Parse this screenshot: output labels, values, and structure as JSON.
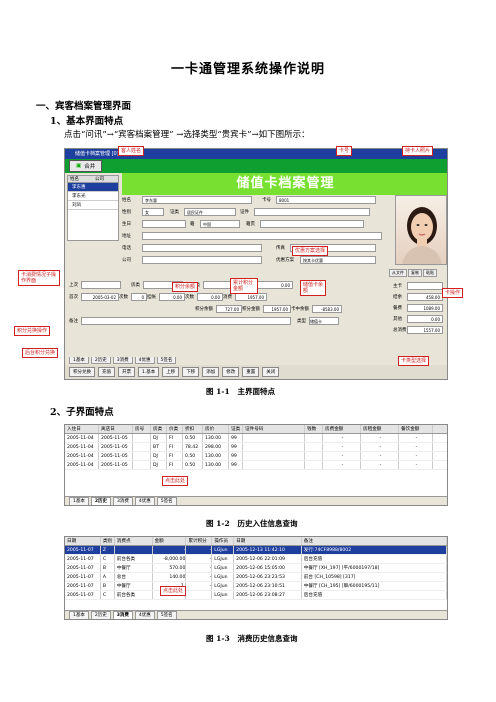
{
  "doc": {
    "title": "一卡通管理系统操作说明",
    "section1": "一、宾客档案管理界面",
    "sub1": "1、基本界面特点",
    "para1": "点击“问讯”→“宾客档案管理” →选择类型“贵宾卡”→如下图所示：",
    "sub2": "2、子界面特点"
  },
  "fig1": {
    "window_title": "储值卡档案管理 [0]",
    "merge_button": "合并",
    "card_title": "储值卡档案管理",
    "list_headers": [
      "姓名",
      "公司"
    ],
    "list_rows": [
      "李东惠",
      "李东光",
      "刘凤"
    ],
    "form": {
      "name_label": "姓名",
      "name_value": "李东惠",
      "card_label": "卡号",
      "card_value": "8001",
      "gender_label": "性别",
      "gender_value": "女",
      "idtype_label": "证类",
      "idtype_value": "居民证件",
      "idno_label": "证件",
      "birthday_label": "生日",
      "nation_label": "籍",
      "nation_value": "中国",
      "ethnic_label": "籍贯",
      "address_label": "地址",
      "phone_label": "电话",
      "fax_label": "传真",
      "company_label": "公司",
      "plan_label": "优惠方案",
      "plan_value": "按其卡优惠"
    },
    "stats": {
      "r1": [
        "上次",
        "房类",
        "价类",
        "房号",
        "0.00"
      ],
      "r2": [
        "首次",
        "2005-03-02",
        "次数",
        "0",
        "挂帐",
        "0.00",
        "次数",
        "0.00",
        "消费",
        "1957.00"
      ],
      "r3": [
        "积分余额",
        "727.00",
        "积分金额",
        "1957.00",
        "卡中余额",
        "-8583.00"
      ],
      "r4": [
        "类型",
        "储值卡",
        "总消费",
        "1557.00"
      ],
      "remark_label": "备注"
    },
    "right": [
      {
        "k": "主卡",
        "v": ""
      },
      {
        "k": "结余",
        "v": "458.00"
      },
      {
        "k": "餐费",
        "v": "1089.00"
      },
      {
        "k": "其他",
        "v": "0.00"
      },
      {
        "k": "总消费",
        "v": "1557.00"
      }
    ],
    "photo_buttons": [
      "从文件",
      "复制",
      "粘贴"
    ],
    "tabs": [
      "1基本",
      "2历史",
      "3消费",
      "4优惠",
      "5签名"
    ],
    "toolbar": [
      "积分兑换",
      "充值",
      "开票",
      "1.基本",
      "上移",
      "下移",
      "添加",
      "修改",
      "重置",
      "关闭"
    ]
  },
  "callouts": {
    "name_change": "客人姓名",
    "card_no": "卡号",
    "holder_photo": "持卡人照片",
    "plan_select": "优惠方案选择",
    "spend_detail": "卡消费情况子操作界面",
    "points_balance": "积分余额",
    "accum_points": "累计积分金额",
    "stored_balance": "储值卡余额",
    "card_action": "卡操作",
    "points_redeem": "积分兑换操作",
    "bg_points": "后台积分兑换",
    "card_type": "卡类型选择",
    "click_here": "点击此处",
    "click_here2": "点击此处"
  },
  "fig1_caption": {
    "num": "图 1-1",
    "text": "主界面特点"
  },
  "fig2": {
    "headers": [
      "入住日",
      "离店日",
      "房号",
      "房类",
      "价类",
      "折扣",
      "房价",
      "证类",
      "证件号码",
      "钱数",
      "房费金额",
      "房租金额",
      "餐饮金额"
    ],
    "rows": [
      [
        "2005-11-04",
        "2005-11-05",
        "",
        "DJ",
        "FI",
        "0.50",
        "130.00",
        "99",
        "",
        "",
        "-",
        "-",
        "-"
      ],
      [
        "2005-11-04",
        "2005-11-05",
        "",
        "BT",
        "FI",
        "78.42",
        "298.00",
        "99",
        "",
        "",
        "-",
        "-",
        "-"
      ],
      [
        "2005-11-04",
        "2005-11-05",
        "",
        "DJ",
        "FI",
        "0.50",
        "130.00",
        "99",
        "",
        "",
        "-",
        "-",
        "-"
      ],
      [
        "2005-11-04",
        "2005-11-05",
        "",
        "DJ",
        "FI",
        "0.50",
        "130.00",
        "99",
        "",
        "",
        "-",
        "-",
        "-"
      ]
    ],
    "tabs": [
      "1基本",
      "2历史",
      "3消费",
      "4优惠",
      "5签名"
    ]
  },
  "fig2_caption": {
    "num": "图 1-2",
    "text": "历史入住信息查询"
  },
  "fig3": {
    "headers": [
      "日期",
      "类别",
      "消费点",
      "金额",
      "累计积分",
      "操作员",
      "日期",
      "备注"
    ],
    "rows": [
      [
        "2005-11-07",
        "Z",
        "",
        "-",
        "-",
        "LGJun",
        "2005-12-13 11:42:10",
        "发行:74CF8988/8002"
      ],
      [
        "2005-11-07",
        "C",
        "前台各类",
        "-8,000.00",
        "-",
        "LGJun",
        "2005-12-06 22:01:09",
        "后台充值"
      ],
      [
        "2005-11-07",
        "B",
        "中餐厅",
        "570.00",
        "-",
        "LGJun",
        "2005-12-06 15:05:00",
        "中餐厅 [XH_197] [平/6000197/18]"
      ],
      [
        "2005-11-07",
        "A",
        "总台",
        "140.00",
        "-",
        "LGJun",
        "2005-12-06 23:23:53",
        "前台 [CH_10598] [317]"
      ],
      [
        "2005-11-07",
        "B",
        "中餐厅",
        "1,",
        "-",
        "LGJun",
        "2005-12-06 23:10:51",
        "中餐厅 [CH_195] [聊/6000195/11]"
      ],
      [
        "2005-11-07",
        "C",
        "前台各类",
        "-8",
        "",
        "LGJun",
        "2005-12-06 23:08:27",
        "后台充值"
      ]
    ],
    "tabs": [
      "1基本",
      "2历史",
      "3消费",
      "4优惠",
      "5签名"
    ]
  },
  "fig3_caption": {
    "num": "图 1-3",
    "text": "消费历史信息查询"
  }
}
